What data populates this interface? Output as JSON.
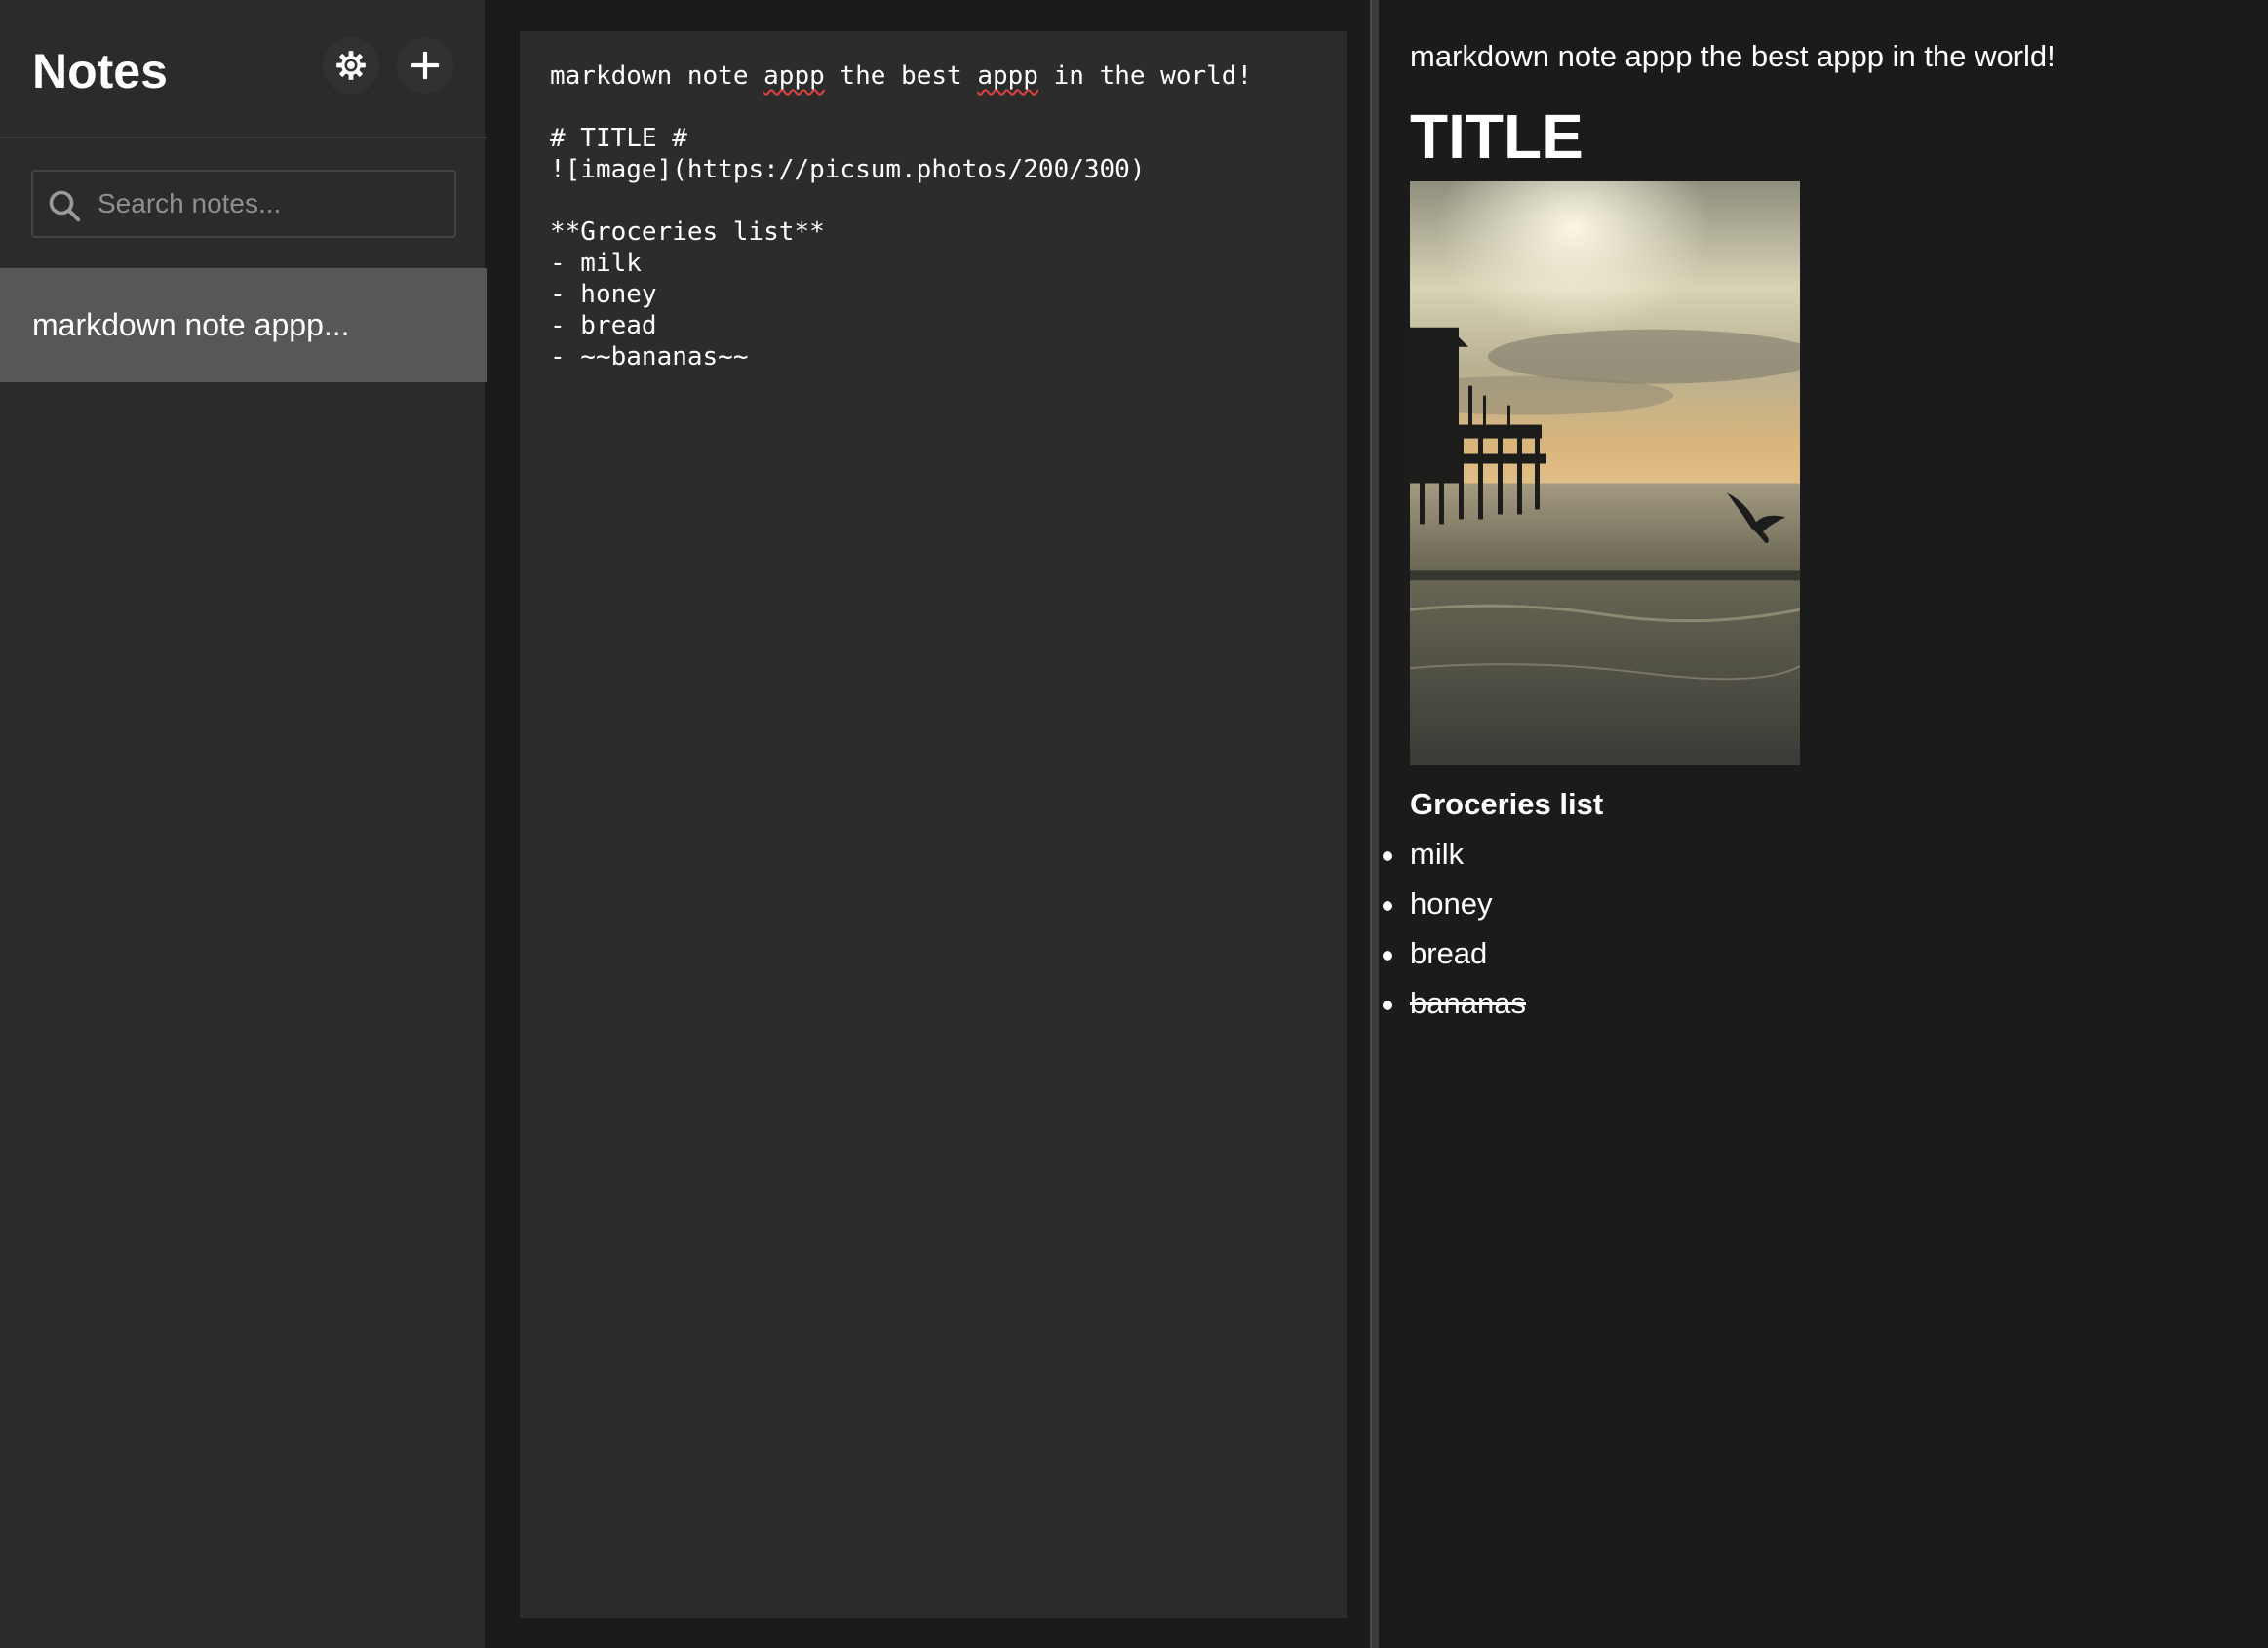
{
  "sidebar": {
    "title": "Notes",
    "settings_icon": "gear-icon",
    "add_icon": "plus-icon",
    "search": {
      "placeholder": "Search notes...",
      "value": "",
      "icon": "search-icon"
    },
    "notes": [
      {
        "title": "markdown note appp..."
      }
    ]
  },
  "editor": {
    "lines": {
      "l1_a": "markdown note ",
      "l1_b": "appp",
      "l1_c": " the best ",
      "l1_d": "appp",
      "l1_e": " in the world!",
      "l2": "",
      "l3": "# TITLE #",
      "l4": "![image](https://picsum.photos/200/300)",
      "l5": "",
      "l6": "**Groceries list**",
      "l7": "- milk",
      "l8": "- honey",
      "l9": "- bread",
      "l10": "- ~~bananas~~"
    }
  },
  "preview": {
    "intro": "markdown note appp the best appp in the world!",
    "heading": "TITLE",
    "image_alt": "image",
    "bold_text": "Groceries list",
    "list": [
      "milk",
      "honey",
      "bread",
      "bananas"
    ],
    "struck_item": "bananas"
  },
  "colors": {
    "background": "#1b1b1b",
    "sidebar": "#2b2b2b",
    "selected_note": "#575757",
    "editor_card": "#2c2c2c",
    "text": "#ffffff",
    "spellcheck": "#e04040"
  }
}
